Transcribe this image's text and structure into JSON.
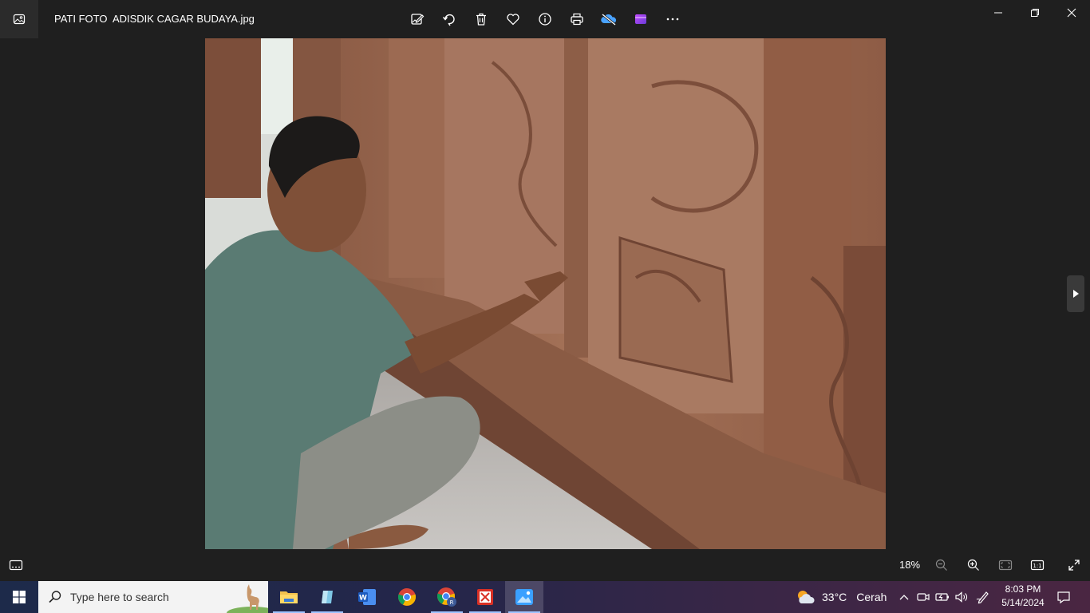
{
  "window": {
    "title": "PATI FOTO  ADISDIK CAGAR BUDAYA.jpg"
  },
  "toolbar": {
    "buttons": [
      "edit-image-icon",
      "rotate-icon",
      "delete-icon",
      "favorite-icon",
      "info-icon",
      "print-icon",
      "onedrive-icon",
      "clipchamp-icon",
      "more-icon"
    ]
  },
  "viewer": {
    "zoom": "18%"
  },
  "taskbar": {
    "search_placeholder": "Type here to search",
    "weather_temp": "33°C",
    "weather_desc": "Cerah",
    "time": "8:03 PM",
    "date": "5/14/2024"
  },
  "colors": {
    "background": "#1f1f1f",
    "accent": "#9ec3ff"
  }
}
